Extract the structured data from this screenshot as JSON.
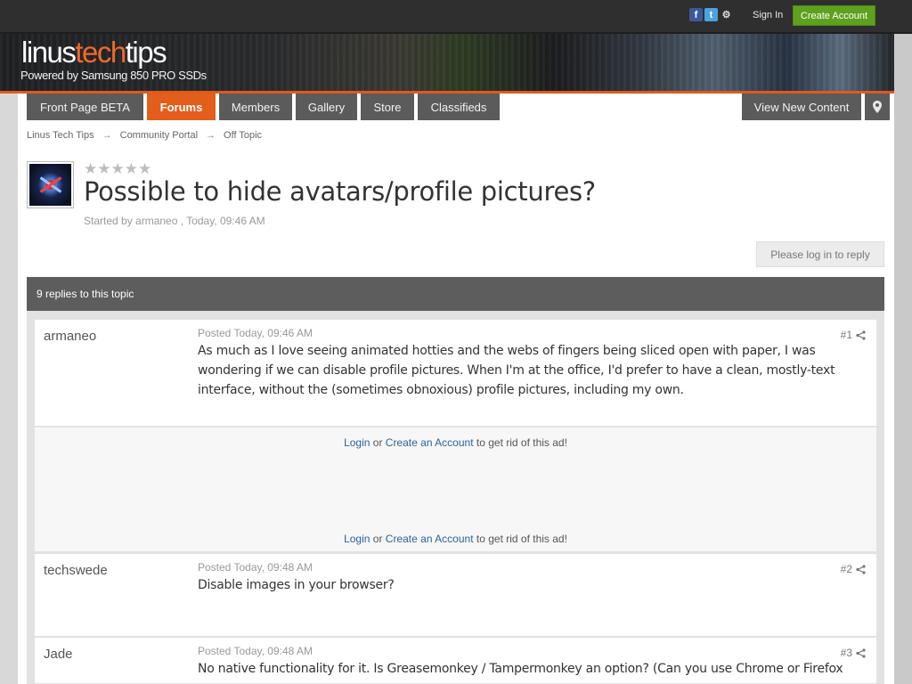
{
  "header": {
    "social": {
      "facebook": "f",
      "twitter": "t",
      "steam": "⚙"
    },
    "sign_in": "Sign In",
    "create_account": "Create Account"
  },
  "banner": {
    "logo_part1": "linus",
    "logo_part2": "tech",
    "logo_part3": "tips",
    "tagline": "Powered by Samsung 850 PRO SSDs"
  },
  "nav": {
    "tabs": [
      {
        "label": "Front Page BETA"
      },
      {
        "label": "Forums",
        "active": true
      },
      {
        "label": "Members"
      },
      {
        "label": "Gallery"
      },
      {
        "label": "Store"
      },
      {
        "label": "Classifieds"
      }
    ],
    "view_new_content": "View New Content",
    "location_icon": "map-pin-icon"
  },
  "breadcrumb": {
    "items": [
      "Linus Tech Tips",
      "Community Portal",
      "Off Topic"
    ],
    "separator": "→"
  },
  "topic": {
    "rating_stars": "★★★★★",
    "title": "Possible to hide avatars/profile pictures?",
    "started_by": "Started by armaneo , Today, 09:46 AM",
    "reply_button": "Please log in to reply",
    "replies_count": "9 replies to this topic"
  },
  "posts": [
    {
      "author": "armaneo",
      "posted": "Posted Today, 09:46 AM",
      "number": "#1",
      "body": "As much as I love seeing animated hotties and the webs of fingers being sliced open with paper, I was wondering if we can disable profile pictures.  When I'm at the office, I'd prefer to have a clean, mostly-text interface, without the (sometimes obnoxious) profile pictures, including my own."
    },
    {
      "author": "techswede",
      "posted": "Posted Today, 09:48 AM",
      "number": "#2",
      "body": "Disable images in your browser?"
    },
    {
      "author": "Jade",
      "posted": "Posted Today, 09:48 AM",
      "number": "#3",
      "body": "No native functionality for it. Is Greasemonkey / Tampermonkey an option? (Can you use Chrome or Firefox"
    }
  ],
  "ad": {
    "login": "Login",
    "or": "or",
    "create": "Create an Account",
    "suffix": "to get rid of this ad!"
  },
  "colors": {
    "accent": "#e35d1b",
    "nav_bg": "#5b5b5b",
    "create_account_bg": "#5fa01e",
    "link": "#2a6496"
  }
}
